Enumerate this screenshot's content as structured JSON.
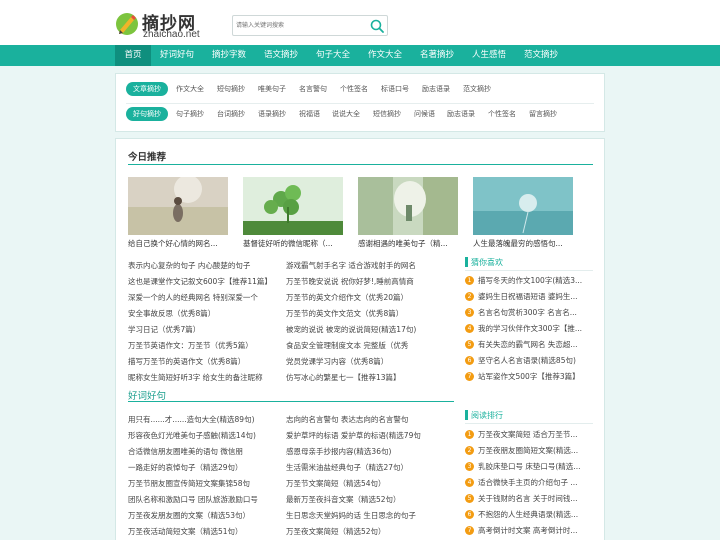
{
  "header": {
    "logo_title": "摘抄网",
    "logo_sub": "zhaichao.net",
    "search_placeholder": "请输入关键词搜索"
  },
  "nav": [
    "首页",
    "好词好句",
    "摘抄字数",
    "语文摘抄",
    "句子大全",
    "作文大全",
    "名著摘抄",
    "人生感悟",
    "范文摘抄"
  ],
  "tag_rows": [
    {
      "pill": "文章摘抄",
      "tags": [
        "作文大全",
        "短句摘抄",
        "唯美句子",
        "名言警句",
        "个性签名",
        "标语口号",
        "励志语录",
        "范文摘抄"
      ]
    },
    {
      "pill": "好句摘抄",
      "tags": [
        "句子摘抄",
        "台词摘抄",
        "语录摘抄",
        "祝福语",
        "说说大全",
        "短信摘抄",
        "问候语",
        "励志语录",
        "个性签名",
        "留言摘抄"
      ]
    }
  ],
  "today": {
    "title": "今日推荐",
    "items": [
      "给自己换个好心情的网名...",
      "基督徒好听的微信昵称（...",
      "感谢相遇的唯美句子（精...",
      "人生最落魄最穷的感悟句..."
    ]
  },
  "today_list": {
    "left": [
      "表示内心复杂的句子 内心酸楚的句子",
      "这也是课堂作文记叙文600字【推荐11篇】",
      "深爱一个的人的经典网名 特别深爱一个",
      "安全事故反思（优秀8篇）",
      "学习日记（优秀7篇）",
      "万圣节英语作文：万圣节（优秀5篇）",
      "描写万圣节的英语作文（优秀8篇）",
      "昵称女生简短好听3字 给女生的备注昵称"
    ],
    "right": [
      "游戏霸气射手名字 适合游戏射手的网名",
      "万圣节晚安说说 祝你好梦!,睡前高情商",
      "万圣节的英文介绍作文（优秀20篇）",
      "万圣节的英文作文范文（优秀8篇）",
      "被宠的说说 被宠的说说简短(精选17句)",
      "食品安全管理制度文本 完整版（优秀",
      "党员党课学习内容（优秀8篇）",
      "仿写冰心的繁星七一【推荐13篇】"
    ]
  },
  "sidebar_fav": {
    "title": "猜你喜欢",
    "items": [
      "描写冬天的作文100字(精选3...",
      "婆妈生日祝福语短语 婆妈生...",
      "名言名句赏析300字 名言名...",
      "我的学习伙伴作文300字【推...",
      "有关失恋的霸气网名 失恋超...",
      "坚守名人名言语录(精选85句)",
      "站军姿作文500字【推荐3篇】"
    ]
  },
  "good": {
    "title": "好词好句",
    "left": [
      "用只有......才......造句大全(精选89句)",
      "形容夜色灯光唯美句子感触(精选14句)",
      "合适微信朋友圈唯美的语句 微信朋",
      "一路走好的哀悼句子（精选29句）",
      "万圣节朋友圈宣传简短文案集锦58句",
      "团队名称和激励口号 团队旅游激励口号",
      "万圣夜发朋友圈的文案（精选53句）",
      "万圣夜活动简短文案（精选51句）"
    ],
    "right": [
      "志向的名言警句 表达志向的名言警句",
      "爱护草坪的标语 爱护草的标语(精选79句",
      "感恩母亲手抄报内容(精选36句)",
      "生活需米油盐经典句子（精选27句）",
      "万圣节文案简短（精选54句）",
      "最新万圣夜抖音文案（精选52句）",
      "生日思念天堂妈妈的话 生日思念的句子",
      "万圣夜文案简短（精选52句）"
    ]
  },
  "sidebar_rank": {
    "title": "阅读排行",
    "items": [
      "万圣夜文案简短 适合万圣节...",
      "万圣夜朋友圈简短文案(精选...",
      "乳胶床垫口号 床垫口号(精选...",
      "适合微快手主页的介绍句子 ...",
      "关于钱财的名言 关于时间钱...",
      "不抱怨的人生经典语录(精选...",
      "高考倒计时文案 高考倒计时..."
    ]
  },
  "colors": {
    "accent": "#1ab19d",
    "badge": "#f39c12"
  }
}
